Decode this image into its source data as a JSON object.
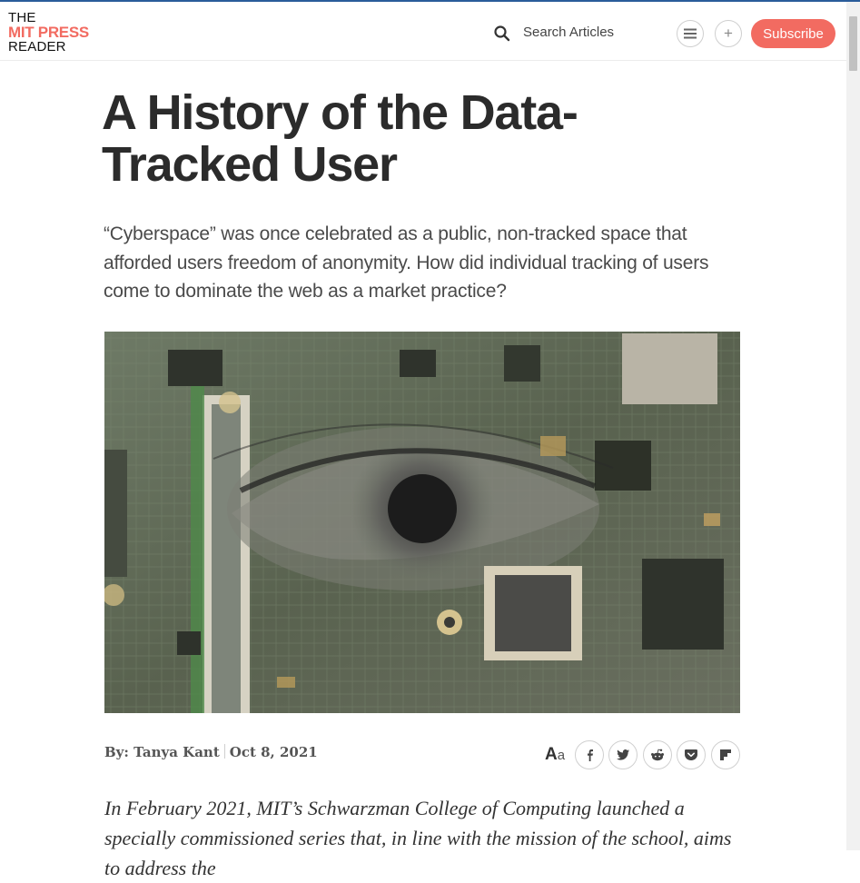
{
  "header": {
    "logo_line1": "THE",
    "logo_line2": "MIT PRESS",
    "logo_line3": "READER",
    "search_label": "Search Articles",
    "plus_label": "+",
    "subscribe_label": "Subscribe"
  },
  "article": {
    "title": "A History of the Data-Tracked User",
    "dek": "“Cyberspace” was once celebrated as a public, non-tracked space that afforded users freedom of anonymity. How did individual tracking of users come to dominate the web as a market practice?",
    "byline_author": "By: Tanya Kant",
    "byline_date": "Oct 8, 2021",
    "text_size_big": "A",
    "text_size_small": "a",
    "share_buttons": [
      "facebook",
      "twitter",
      "reddit",
      "pocket",
      "flipboard"
    ],
    "body_intro": "In February 2021, MIT’s Schwarzman College of Computing launched a specially commissioned series that, in line with the mission of the school, aims to address the"
  },
  "colors": {
    "brand": "#f26b61",
    "topline": "#2a5c9a",
    "text": "#2b2b2b"
  },
  "icons": {
    "search": "search-icon",
    "menu": "hamburger-menu-icon",
    "plus": "plus-icon"
  }
}
